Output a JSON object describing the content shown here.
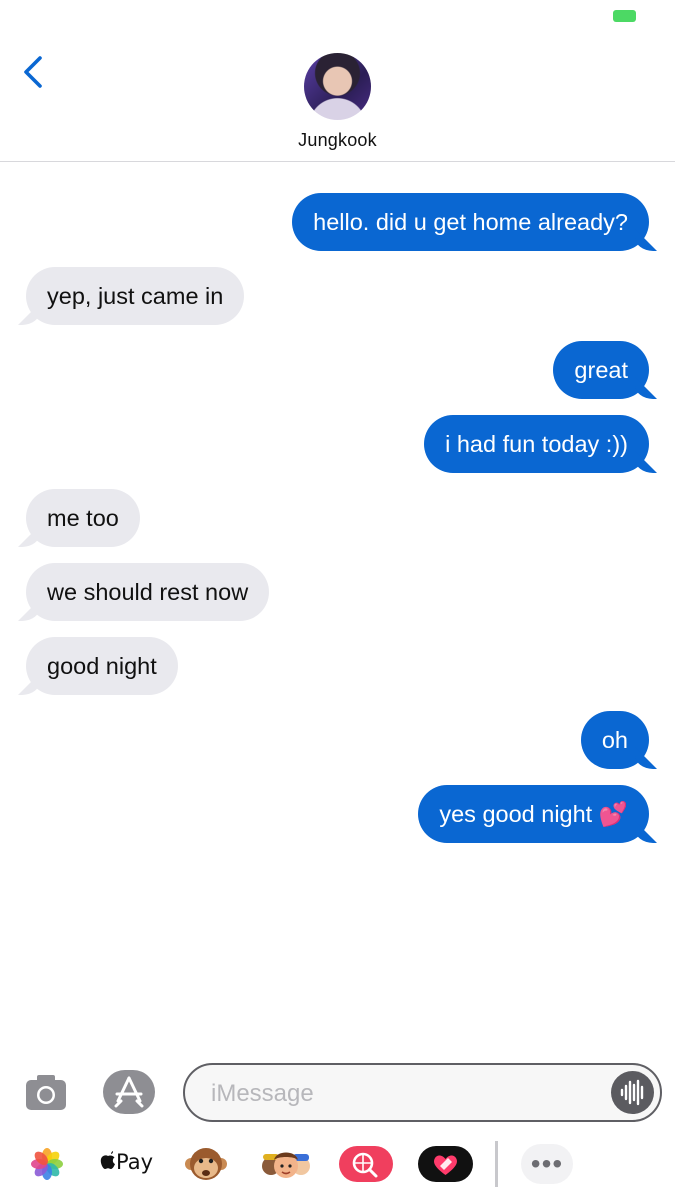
{
  "status_bar": {
    "battery_color": "#4cd964"
  },
  "header": {
    "back_icon": "chevron-left-icon",
    "contact_name": "Jungkook",
    "avatar": "contact-avatar-photo"
  },
  "messages": [
    {
      "from": "me",
      "text": "hello. did u get home already?"
    },
    {
      "from": "them",
      "text": "yep, just came in"
    },
    {
      "from": "me",
      "text": "great"
    },
    {
      "from": "me",
      "text": "i had fun today :))"
    },
    {
      "from": "them",
      "text": "me too"
    },
    {
      "from": "them",
      "text": "we should rest now"
    },
    {
      "from": "them",
      "text": "good night"
    },
    {
      "from": "me",
      "text": "oh"
    },
    {
      "from": "me",
      "text": "yes good night 💕"
    }
  ],
  "composer": {
    "camera_icon": "camera-icon",
    "apps_icon": "app-store-icon",
    "placeholder": "iMessage",
    "audio_icon": "audio-waveform-icon"
  },
  "app_drawer": {
    "items": [
      {
        "name": "photos",
        "icon": "photos-icon"
      },
      {
        "name": "apple-pay",
        "label": "Pay",
        "icon": "apple-logo-icon"
      },
      {
        "name": "animoji",
        "icon": "monkey-icon"
      },
      {
        "name": "memoji-stickers",
        "icon": "memoji-icon"
      },
      {
        "name": "images-search",
        "icon": "globe-search-icon"
      },
      {
        "name": "digital-touch",
        "icon": "heart-touch-icon"
      },
      {
        "name": "more",
        "label": "•••",
        "icon": "more-icon"
      }
    ]
  },
  "colors": {
    "sent_bubble": "#0a67d2",
    "received_bubble": "#e9e9ee",
    "accent": "#0a67d2"
  }
}
